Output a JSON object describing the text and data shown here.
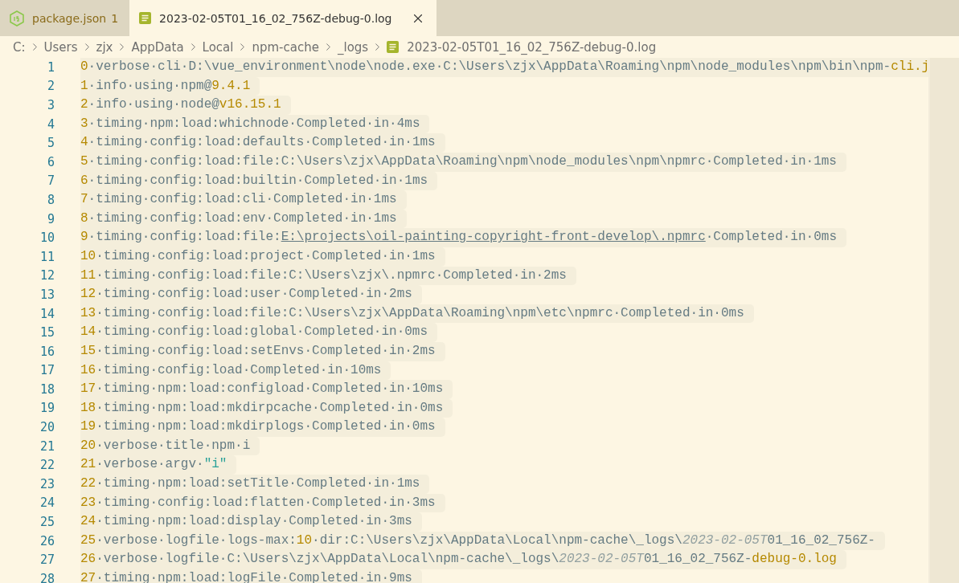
{
  "tabs": [
    {
      "label": "package.json",
      "badge": "1",
      "kind": "js",
      "selected": false
    },
    {
      "label": "2023-02-05T01_16_02_756Z-debug-0.log",
      "kind": "log",
      "selected": true
    }
  ],
  "breadcrumb": {
    "segments": [
      "C:",
      "Users",
      "zjx",
      "AppData",
      "Local",
      "npm-cache",
      "_logs"
    ],
    "file": "2023-02-05T01_16_02_756Z-debug-0.log"
  },
  "lines": [
    {
      "number": "1",
      "segments": [
        {
          "kind": "number",
          "text": "0"
        },
        {
          "kind": "plain",
          "text": "·verbose·cli·D:\\vue_environment\\node\\node.exe·C:\\Users\\zjx\\AppData\\Roaming\\npm\\node_modules\\npm\\bin\\npm-"
        },
        {
          "kind": "number",
          "text": "cli.j"
        }
      ]
    },
    {
      "number": "2",
      "segments": [
        {
          "kind": "number",
          "text": "1"
        },
        {
          "kind": "plain",
          "text": "·info·using·npm@"
        },
        {
          "kind": "number",
          "text": "9.4.1"
        }
      ]
    },
    {
      "number": "3",
      "segments": [
        {
          "kind": "number",
          "text": "2"
        },
        {
          "kind": "plain",
          "text": "·info·using·node@"
        },
        {
          "kind": "number",
          "text": "v16.15.1"
        }
      ]
    },
    {
      "number": "4",
      "segments": [
        {
          "kind": "number",
          "text": "3"
        },
        {
          "kind": "plain",
          "text": "·timing·npm:load:whichnode·Completed·in·4ms"
        }
      ]
    },
    {
      "number": "5",
      "segments": [
        {
          "kind": "number",
          "text": "4"
        },
        {
          "kind": "plain",
          "text": "·timing·config:load:defaults·Completed·in·1ms"
        }
      ]
    },
    {
      "number": "6",
      "segments": [
        {
          "kind": "number",
          "text": "5"
        },
        {
          "kind": "plain",
          "text": "·timing·config:load:file:C:\\Users\\zjx\\AppData\\Roaming\\npm\\node_modules\\npm\\npmrc·Completed·in·1ms"
        }
      ]
    },
    {
      "number": "7",
      "segments": [
        {
          "kind": "number",
          "text": "6"
        },
        {
          "kind": "plain",
          "text": "·timing·config:load:builtin·Completed·in·1ms"
        }
      ]
    },
    {
      "number": "8",
      "segments": [
        {
          "kind": "number",
          "text": "7"
        },
        {
          "kind": "plain",
          "text": "·timing·config:load:cli·Completed·in·1ms"
        }
      ]
    },
    {
      "number": "9",
      "segments": [
        {
          "kind": "number",
          "text": "8"
        },
        {
          "kind": "plain",
          "text": "·timing·config:load:env·Completed·in·1ms"
        }
      ]
    },
    {
      "number": "10",
      "segments": [
        {
          "kind": "number",
          "text": "9"
        },
        {
          "kind": "plain",
          "text": "·timing·config:load:file:"
        },
        {
          "kind": "link",
          "text": "E:\\projects\\oil-painting-copyright-front-develop\\.npmrc"
        },
        {
          "kind": "plain",
          "text": "·Completed·in·0ms"
        }
      ]
    },
    {
      "number": "11",
      "segments": [
        {
          "kind": "number",
          "text": "10"
        },
        {
          "kind": "plain",
          "text": "·timing·config:load:project·Completed·in·1ms"
        }
      ]
    },
    {
      "number": "12",
      "segments": [
        {
          "kind": "number",
          "text": "11"
        },
        {
          "kind": "plain",
          "text": "·timing·config:load:file:C:\\Users\\zjx\\.npmrc·Completed·in·2ms"
        }
      ]
    },
    {
      "number": "13",
      "segments": [
        {
          "kind": "number",
          "text": "12"
        },
        {
          "kind": "plain",
          "text": "·timing·config:load:user·Completed·in·2ms"
        }
      ]
    },
    {
      "number": "14",
      "segments": [
        {
          "kind": "number",
          "text": "13"
        },
        {
          "kind": "plain",
          "text": "·timing·config:load:file:C:\\Users\\zjx\\AppData\\Roaming\\npm\\etc\\npmrc·Completed·in·0ms"
        }
      ]
    },
    {
      "number": "15",
      "segments": [
        {
          "kind": "number",
          "text": "14"
        },
        {
          "kind": "plain",
          "text": "·timing·config:load:global·Completed·in·0ms"
        }
      ]
    },
    {
      "number": "16",
      "segments": [
        {
          "kind": "number",
          "text": "15"
        },
        {
          "kind": "plain",
          "text": "·timing·config:load:setEnvs·Completed·in·2ms"
        }
      ]
    },
    {
      "number": "17",
      "segments": [
        {
          "kind": "number",
          "text": "16"
        },
        {
          "kind": "plain",
          "text": "·timing·config:load·Completed·in·10ms"
        }
      ]
    },
    {
      "number": "18",
      "segments": [
        {
          "kind": "number",
          "text": "17"
        },
        {
          "kind": "plain",
          "text": "·timing·npm:load:configload·Completed·in·10ms"
        }
      ]
    },
    {
      "number": "19",
      "segments": [
        {
          "kind": "number",
          "text": "18"
        },
        {
          "kind": "plain",
          "text": "·timing·npm:load:mkdirpcache·Completed·in·0ms"
        }
      ]
    },
    {
      "number": "20",
      "segments": [
        {
          "kind": "number",
          "text": "19"
        },
        {
          "kind": "plain",
          "text": "·timing·npm:load:mkdirplogs·Completed·in·0ms"
        }
      ]
    },
    {
      "number": "21",
      "segments": [
        {
          "kind": "number",
          "text": "20"
        },
        {
          "kind": "plain",
          "text": "·verbose·title·npm·i"
        }
      ]
    },
    {
      "number": "22",
      "segments": [
        {
          "kind": "number",
          "text": "21"
        },
        {
          "kind": "plain",
          "text": "·verbose·argv·"
        },
        {
          "kind": "string",
          "text": "\"i\""
        }
      ]
    },
    {
      "number": "23",
      "segments": [
        {
          "kind": "number",
          "text": "22"
        },
        {
          "kind": "plain",
          "text": "·timing·npm:load:setTitle·Completed·in·1ms"
        }
      ]
    },
    {
      "number": "24",
      "segments": [
        {
          "kind": "number",
          "text": "23"
        },
        {
          "kind": "plain",
          "text": "·timing·config:load:flatten·Completed·in·3ms"
        }
      ]
    },
    {
      "number": "25",
      "segments": [
        {
          "kind": "number",
          "text": "24"
        },
        {
          "kind": "plain",
          "text": "·timing·npm:load:display·Completed·in·3ms"
        }
      ]
    },
    {
      "number": "26",
      "segments": [
        {
          "kind": "number",
          "text": "25"
        },
        {
          "kind": "plain",
          "text": "·verbose·logfile·logs-max:"
        },
        {
          "kind": "number",
          "text": "10"
        },
        {
          "kind": "plain",
          "text": "·dir:C:\\Users\\zjx\\AppData\\Local\\npm-cache\\_logs\\"
        },
        {
          "kind": "date",
          "text": "2023-02-05T"
        },
        {
          "kind": "plain",
          "text": "01_16_02_756Z-"
        }
      ]
    },
    {
      "number": "27",
      "segments": [
        {
          "kind": "number",
          "text": "26"
        },
        {
          "kind": "plain",
          "text": "·verbose·logfile·C:\\Users\\zjx\\AppData\\Local\\npm-cache\\_logs\\"
        },
        {
          "kind": "date",
          "text": "2023-02-05T"
        },
        {
          "kind": "plain",
          "text": "01_16_02_756Z-"
        },
        {
          "kind": "number",
          "text": "debug-0.log"
        }
      ]
    },
    {
      "number": "28",
      "segments": [
        {
          "kind": "number",
          "text": "27"
        },
        {
          "kind": "plain",
          "text": "·timing·npm:load:logFile·Completed·in·9ms"
        }
      ]
    }
  ]
}
